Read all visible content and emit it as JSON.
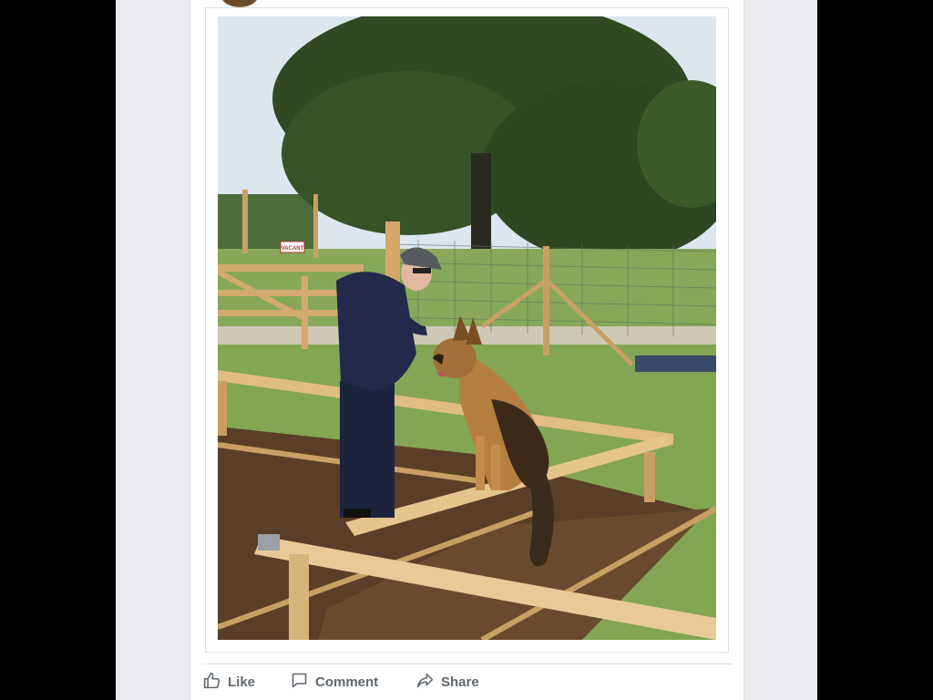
{
  "post": {
    "photo_alt": "",
    "photo_sign_text": "VACANT"
  },
  "actions": {
    "like_label": "Like",
    "comment_label": "Comment",
    "share_label": "Share"
  },
  "icons": {
    "like": "thumbs-up-icon",
    "comment": "speech-bubble-icon",
    "share": "share-arrow-icon"
  },
  "colors": {
    "action_text": "#606770",
    "page_background": "#e9ebee",
    "card_background": "#ffffff"
  }
}
